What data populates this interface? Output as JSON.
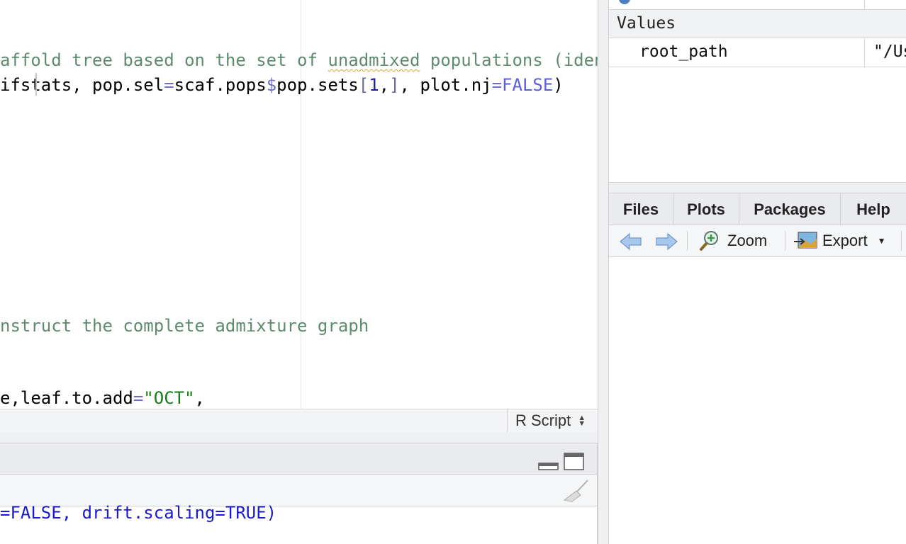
{
  "editor": {
    "lines": [
      {
        "segments": [
          {
            "t": "affold tree based on the set of ",
            "c": "c-comment"
          },
          {
            "t": "unadmixed",
            "c": "c-comment squiggle"
          },
          {
            "t": " populations (iden",
            "c": "c-comment"
          }
        ]
      },
      {
        "segments": [
          {
            "t": "ifstats, pop.sel",
            "c": ""
          },
          {
            "t": "=",
            "c": "c-op"
          },
          {
            "t": "scaf.pops",
            "c": ""
          },
          {
            "t": "$",
            "c": "c-op"
          },
          {
            "t": "pop.sets",
            "c": ""
          },
          {
            "t": "[",
            "c": "c-bracket"
          },
          {
            "t": "1",
            "c": "c-num"
          },
          {
            "t": ",",
            "c": ""
          },
          {
            "t": "]",
            "c": "c-bracket"
          },
          {
            "t": ", plot.nj",
            "c": ""
          },
          {
            "t": "=",
            "c": "c-op"
          },
          {
            "t": "FALSE",
            "c": "c-bool"
          },
          {
            "t": ")",
            "c": ""
          }
        ]
      },
      {
        "segments": [
          {
            "t": "nstruct the complete admixture graph",
            "c": "c-comment"
          }
        ]
      },
      {
        "segments": [
          {
            "t": "e,leaf.to.add",
            "c": ""
          },
          {
            "t": "=",
            "c": "c-op"
          },
          {
            "t": "\"OCT\"",
            "c": "c-str"
          },
          {
            "t": ",",
            "c": ""
          }
        ]
      }
    ],
    "filetype": "R Script"
  },
  "console": {
    "output": "=FALSE, drift.scaling=TRUE)"
  },
  "environment": {
    "section": "Values",
    "rows": [
      {
        "name": "root_path",
        "value": "\"/Us"
      }
    ]
  },
  "tabs": [
    "Files",
    "Plots",
    "Packages",
    "Help"
  ],
  "plots_toolbar": {
    "zoom": "Zoom",
    "export": "Export"
  }
}
